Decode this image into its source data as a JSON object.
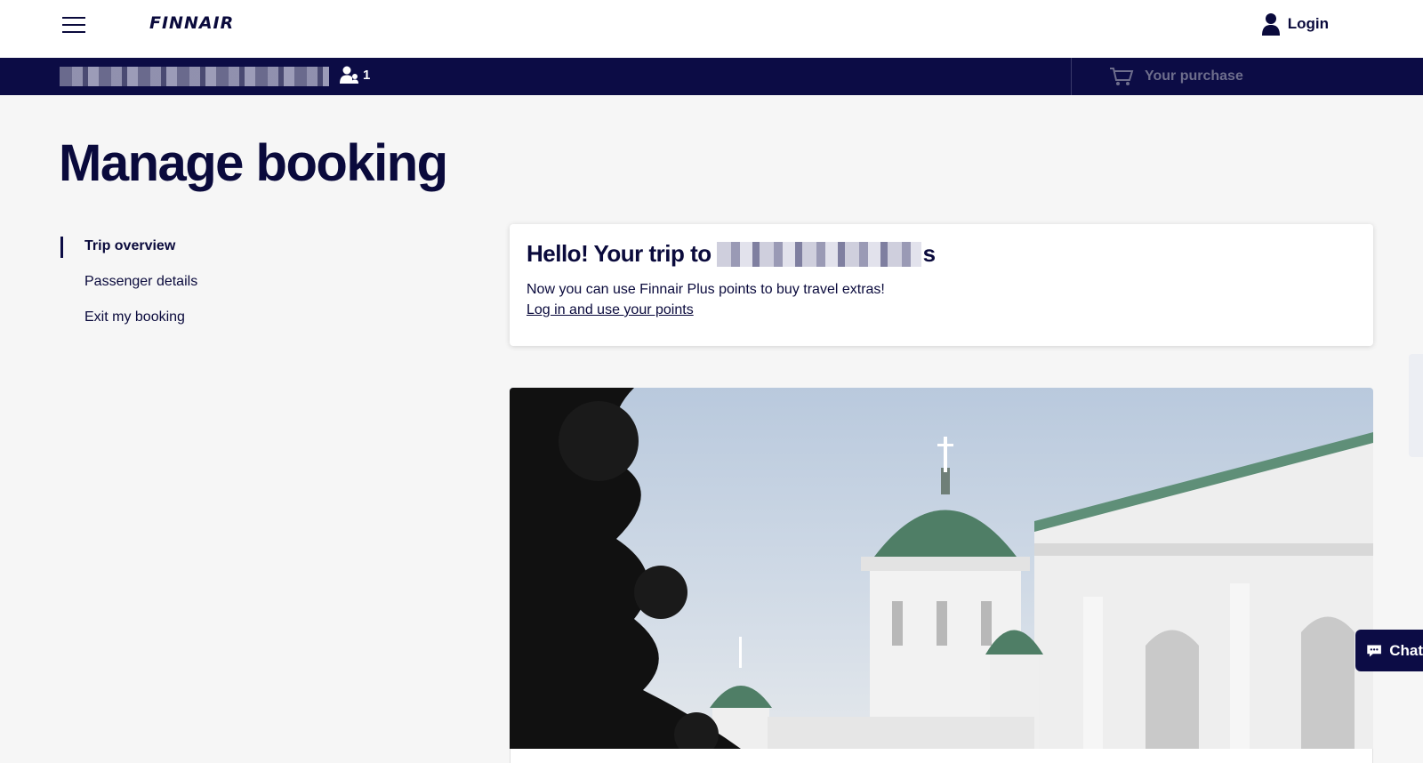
{
  "header": {
    "logo_text": "FINNAIR",
    "login_label": "Login",
    "menu_icon": "hamburger-menu-icon",
    "user_icon": "user-icon"
  },
  "booking_bar": {
    "passenger_count": "1",
    "purchase_label": "Your purchase",
    "cart_icon": "cart-icon"
  },
  "page": {
    "title": "Manage booking"
  },
  "sidenav": {
    "items": [
      {
        "label": "Trip overview",
        "active": true
      },
      {
        "label": "Passenger details",
        "active": false
      },
      {
        "label": "Exit my booking",
        "active": false
      }
    ]
  },
  "greeting_card": {
    "title_prefix": "Hello! Your trip to",
    "title_suffix": "s",
    "body_text": "Now you can use Finnair Plus points to buy travel extras!",
    "link_text": "Log in and use your points"
  },
  "chat_widget": {
    "label": "Chat",
    "icon": "chat-bubble-icon"
  },
  "colors": {
    "brand_navy": "#0c0c45",
    "text": "#0a0a3c",
    "background": "#f6f6f6"
  }
}
